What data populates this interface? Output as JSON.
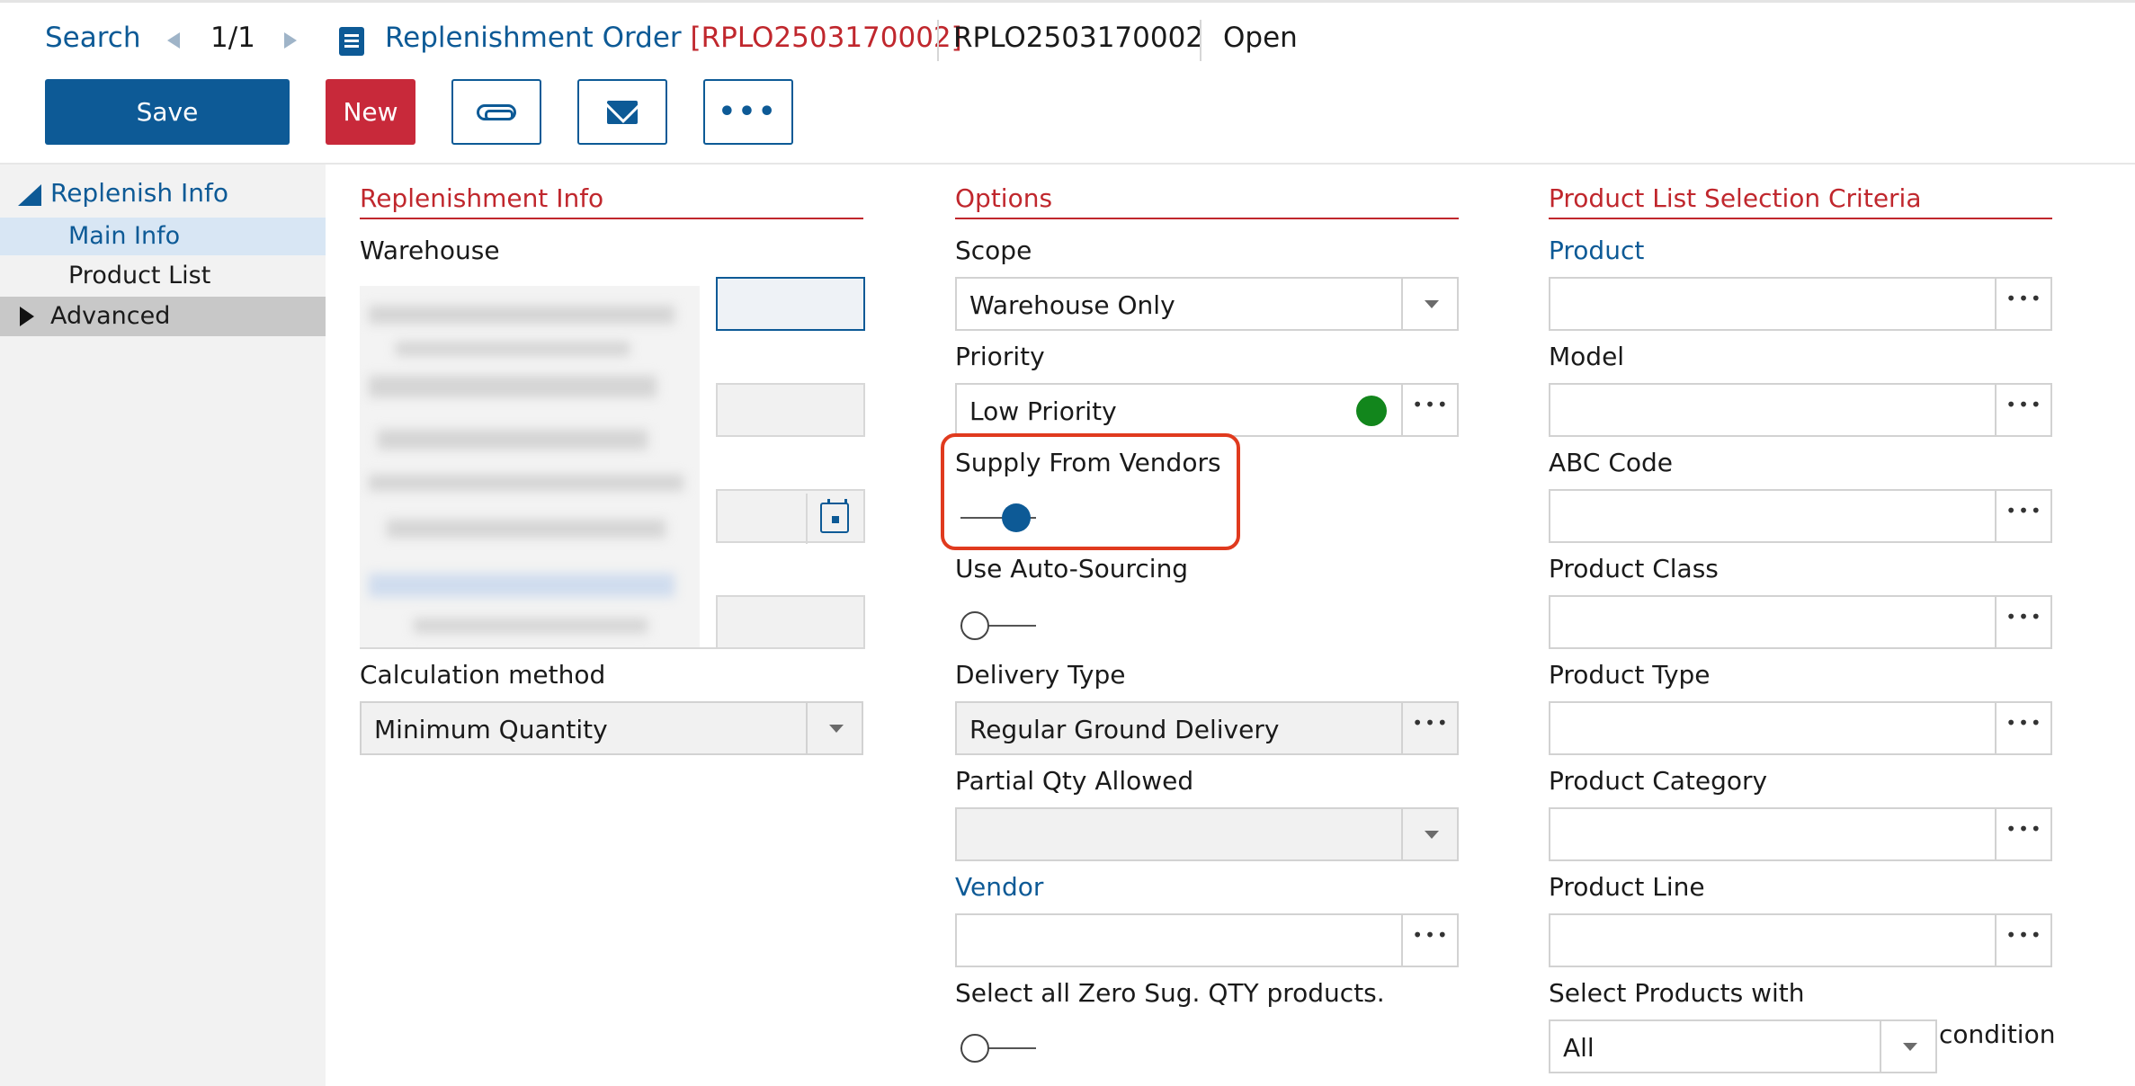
{
  "header": {
    "search": "Search",
    "pager": "1/1",
    "title": "Replenishment Order",
    "title_code": "[RPLO2503170002]",
    "doc_number": "RPLO2503170002",
    "status": "Open"
  },
  "toolbar": {
    "save": "Save",
    "new": "New",
    "more": "•••"
  },
  "sidebar": {
    "group": "Replenish Info",
    "items": [
      "Main Info",
      "Product List"
    ],
    "advanced": "Advanced"
  },
  "replenishment_info": {
    "title": "Replenishment Info",
    "warehouse_label": "Warehouse",
    "calc_label": "Calculation method",
    "calc_value": "Minimum Quantity"
  },
  "options": {
    "title": "Options",
    "scope_label": "Scope",
    "scope_value": "Warehouse Only",
    "priority_label": "Priority",
    "priority_value": "Low Priority",
    "priority_color": "#12861c",
    "supply_label": "Supply From Vendors",
    "supply_on": true,
    "auto_sourcing_label": "Use Auto-Sourcing",
    "auto_sourcing_on": false,
    "delivery_label": "Delivery Type",
    "delivery_value": "Regular Ground Delivery",
    "partial_label": "Partial Qty Allowed",
    "partial_value": "",
    "vendor_label": "Vendor",
    "vendor_value": "",
    "zero_label": "Select all Zero Sug. QTY products.",
    "zero_on": false
  },
  "criteria": {
    "title": "Product List Selection Criteria",
    "product_label": "Product",
    "model_label": "Model",
    "abc_label": "ABC Code",
    "class_label": "Product Class",
    "type_label": "Product Type",
    "category_label": "Product Category",
    "line_label": "Product Line",
    "select_with_label": "Select Products with",
    "select_with_value": "All",
    "condition_label": "condition"
  },
  "colors": {
    "accent": "#0d5a96",
    "danger": "#c8293a",
    "section": "#c0272d",
    "highlight": "#e03a1e"
  }
}
